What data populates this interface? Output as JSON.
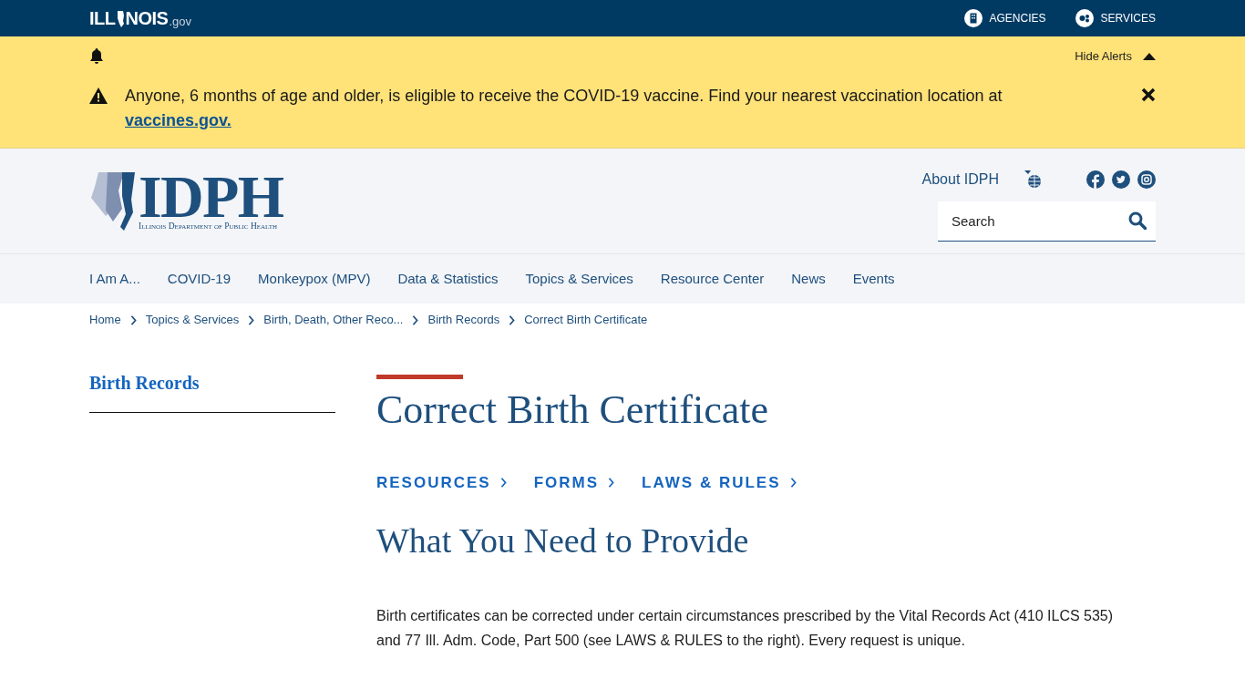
{
  "top_bar": {
    "logo": {
      "before": "ILL",
      "after": "NOIS",
      "suffix": ".gov"
    },
    "links": [
      {
        "label": "AGENCIES",
        "kind": "building"
      },
      {
        "label": "SERVICES",
        "kind": "gears"
      }
    ]
  },
  "alert_bar": {
    "toggle": "Hide Alerts",
    "expanded": true,
    "message": "Anyone, 6 months of age and older, is eligible to receive the COVID-19 vaccine. Find your nearest vaccination location at",
    "link": "vaccines.gov."
  },
  "header": {
    "logo": {
      "title": "IDPH",
      "subtitle": "Illinois Department of Public Health"
    },
    "about": "About IDPH",
    "search": {
      "placeholder": "Search"
    }
  },
  "nav": [
    "I Am A...",
    "COVID-19",
    "Monkeypox (MPV)",
    "Data & Statistics",
    "Topics & Services",
    "Resource Center",
    "News",
    "Events"
  ],
  "breadcrumbs": [
    "Home",
    "Topics & Services",
    "Birth, Death, Other Reco...",
    "Birth Records",
    "Correct Birth Certificate"
  ],
  "sidebar": {
    "title": "Birth Records"
  },
  "main": {
    "title": "Correct Birth Certificate",
    "quick_links": [
      "RESOURCES",
      "FORMS",
      "LAWS & RULES"
    ],
    "heading": "What You Need to Provide",
    "paragraph": "Birth certificates can be corrected under certain circumstances prescribed by the Vital Records Act (410 ILCS 535) and 77 Ill. Adm. Code, Part 500 (see LAWS & RULES to the right). Every request is unique."
  }
}
